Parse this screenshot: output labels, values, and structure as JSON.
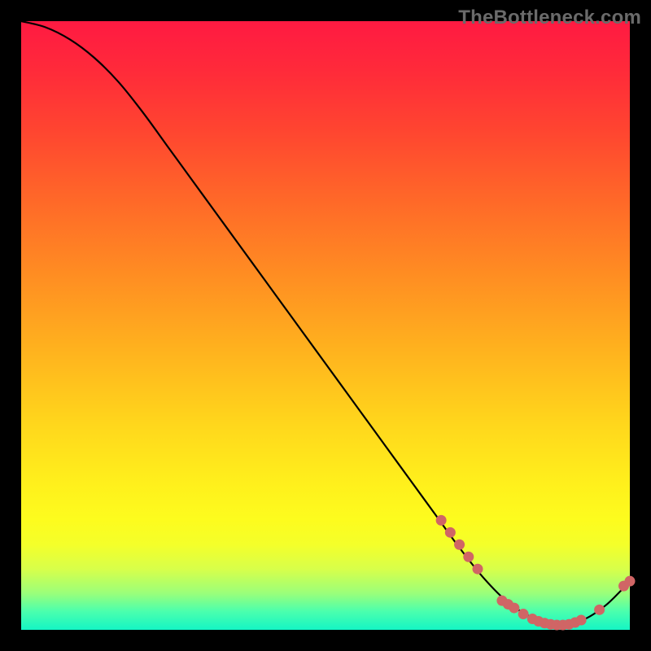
{
  "watermark": "TheBottleneck.com",
  "colors": {
    "curve": "#000000",
    "marker_fill": "#d06565",
    "marker_stroke": "#a84a4a"
  },
  "chart_data": {
    "type": "line",
    "title": "",
    "xlabel": "",
    "ylabel": "",
    "xlim": [
      0,
      100
    ],
    "ylim": [
      0,
      100
    ],
    "x": [
      0,
      4,
      8,
      12,
      16,
      20,
      24,
      28,
      32,
      36,
      40,
      44,
      48,
      52,
      56,
      60,
      64,
      68,
      72,
      76,
      80,
      84,
      88,
      92,
      96,
      100
    ],
    "y": [
      100,
      99,
      97,
      94,
      90,
      85,
      79.5,
      74,
      68.5,
      63,
      57.5,
      52,
      46.5,
      41,
      35.5,
      30,
      24.5,
      19,
      13.5,
      8.5,
      4.5,
      2,
      0.8,
      1.5,
      4,
      8
    ],
    "markers": [
      {
        "x": 69,
        "y": 18
      },
      {
        "x": 70.5,
        "y": 16
      },
      {
        "x": 72,
        "y": 14
      },
      {
        "x": 73.5,
        "y": 12
      },
      {
        "x": 75,
        "y": 10
      },
      {
        "x": 79,
        "y": 4.8
      },
      {
        "x": 80,
        "y": 4.2
      },
      {
        "x": 81,
        "y": 3.6
      },
      {
        "x": 82.5,
        "y": 2.6
      },
      {
        "x": 84,
        "y": 1.8
      },
      {
        "x": 85,
        "y": 1.4
      },
      {
        "x": 86,
        "y": 1.1
      },
      {
        "x": 87,
        "y": 0.9
      },
      {
        "x": 88,
        "y": 0.8
      },
      {
        "x": 89,
        "y": 0.8
      },
      {
        "x": 90,
        "y": 0.9
      },
      {
        "x": 91,
        "y": 1.2
      },
      {
        "x": 92,
        "y": 1.6
      },
      {
        "x": 95,
        "y": 3.3
      },
      {
        "x": 99,
        "y": 7.2
      },
      {
        "x": 100,
        "y": 8
      }
    ]
  }
}
